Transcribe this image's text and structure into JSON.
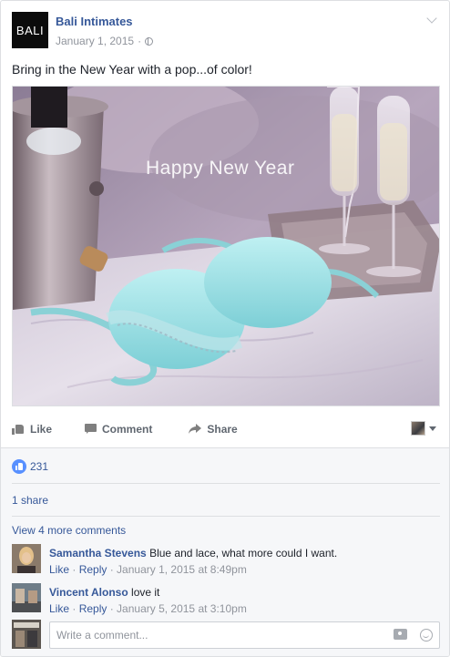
{
  "post": {
    "page_name": "Bali Intimates",
    "logo_text": "BALI",
    "date": "January 1, 2015",
    "date_sep": "·",
    "text": "Bring in the New Year with a pop...of color!",
    "photo_caption": "Happy New Year",
    "photo_icon": "photo-bra-champagne"
  },
  "actions": {
    "like": "Like",
    "comment": "Comment",
    "share": "Share"
  },
  "feedback": {
    "like_count": "231",
    "shares": "1 share",
    "view_more": "View 4 more comments",
    "accent_color": "#365899"
  },
  "comments": [
    {
      "name": "Samantha Stevens",
      "text": "Blue and lace, what more could I want.",
      "like": "Like",
      "reply": "Reply",
      "time": "January 1, 2015 at 8:49pm"
    },
    {
      "name": "Vincent Alonso",
      "text": "love it",
      "like": "Like",
      "reply": "Reply",
      "time": "January 5, 2015 at 3:10pm"
    }
  ],
  "composer": {
    "placeholder": "Write a comment..."
  }
}
